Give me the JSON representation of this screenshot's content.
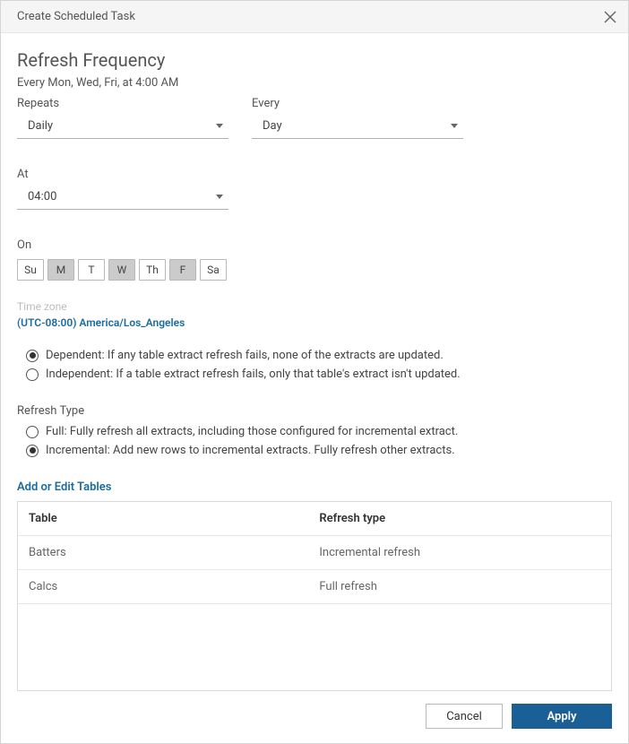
{
  "header": {
    "title": "Create Scheduled Task"
  },
  "page": {
    "title": "Refresh Frequency",
    "summary": "Every Mon, Wed, Fri, at 4:00 AM"
  },
  "repeats": {
    "label": "Repeats",
    "value": "Daily"
  },
  "every": {
    "label": "Every",
    "value": "Day"
  },
  "at": {
    "label": "At",
    "value": "04:00"
  },
  "on": {
    "label": "On",
    "days": [
      {
        "abbr": "Su",
        "selected": false
      },
      {
        "abbr": "M",
        "selected": true
      },
      {
        "abbr": "T",
        "selected": false
      },
      {
        "abbr": "W",
        "selected": true
      },
      {
        "abbr": "Th",
        "selected": false
      },
      {
        "abbr": "F",
        "selected": true
      },
      {
        "abbr": "Sa",
        "selected": false
      }
    ]
  },
  "timezone": {
    "label": "Time zone",
    "value": "(UTC-08:00) America/Los_Angeles"
  },
  "dependency": {
    "options": [
      {
        "label": "Dependent: If any table extract refresh fails, none of the extracts are updated.",
        "selected": true
      },
      {
        "label": "Independent: If a table extract refresh fails, only that table's extract isn't updated.",
        "selected": false
      }
    ]
  },
  "refreshType": {
    "label": "Refresh Type",
    "options": [
      {
        "label": "Full: Fully refresh all extracts, including those configured for incremental extract.",
        "selected": false
      },
      {
        "label": "Incremental: Add new rows to incremental extracts. Fully refresh other extracts.",
        "selected": true
      }
    ]
  },
  "tablesLink": "Add or Edit Tables",
  "table": {
    "headers": {
      "col1": "Table",
      "col2": "Refresh type"
    },
    "rows": [
      {
        "col1": "Batters",
        "col2": "Incremental refresh"
      },
      {
        "col1": "Calcs",
        "col2": "Full refresh"
      }
    ]
  },
  "footer": {
    "cancel": "Cancel",
    "apply": "Apply"
  }
}
